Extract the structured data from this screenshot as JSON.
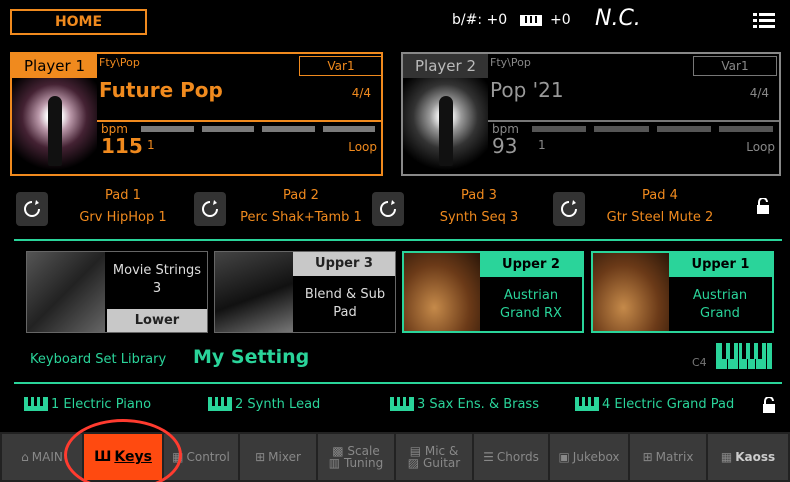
{
  "header": {
    "home_label": "HOME",
    "transpose_label": "b/#: +0",
    "octave_label": "+0",
    "chord_label": "N.C."
  },
  "player1": {
    "title": "Player 1",
    "folder": "Fty\\Pop",
    "variation": "Var1",
    "style": "Future Pop",
    "meter": "4/4",
    "bpm_label": "bpm",
    "bpm": "115",
    "beat": "1",
    "loop": "Loop"
  },
  "player2": {
    "title": "Player 2",
    "folder": "Fty\\Pop",
    "variation": "Var1",
    "style": "Pop '21",
    "meter": "4/4",
    "bpm_label": "bpm",
    "bpm": "93",
    "beat": "1",
    "loop": "Loop"
  },
  "pads": [
    {
      "name": "Pad 1",
      "sound": "Grv HipHop 1"
    },
    {
      "name": "Pad 2",
      "sound": "Perc Shak+Tamb 1"
    },
    {
      "name": "Pad 3",
      "sound": "Synth Seq 3"
    },
    {
      "name": "Pad 4",
      "sound": "Gtr Steel Mute 2"
    }
  ],
  "keyboard_sounds": {
    "lower": {
      "title": "Lower",
      "name_line1": "Movie Strings",
      "name_line2": "3"
    },
    "upper3": {
      "title": "Upper 3",
      "name_line1": "Blend & Sub",
      "name_line2": "Pad"
    },
    "upper2": {
      "title": "Upper 2",
      "name_line1": "Austrian",
      "name_line2": "Grand RX"
    },
    "upper1": {
      "title": "Upper 1",
      "name_line1": "Austrian",
      "name_line2": "Grand"
    }
  },
  "library": {
    "label": "Keyboard Set Library",
    "name": "My Setting",
    "octave": "C4"
  },
  "keyboard_sets": [
    {
      "label": "1  Electric Piano"
    },
    {
      "label": "2  Synth Lead"
    },
    {
      "label": "3  Sax Ens. & Brass"
    },
    {
      "label": "4  Electric Grand Pad"
    }
  ],
  "tabs": [
    {
      "label": "MAIN"
    },
    {
      "label": "Keys"
    },
    {
      "label": "Control"
    },
    {
      "label": "Mixer"
    },
    {
      "label": "Scale",
      "label2": "Tuning"
    },
    {
      "label": "Mic &",
      "label2": "Guitar"
    },
    {
      "label": "Chords"
    },
    {
      "label": "Jukebox"
    },
    {
      "label": "Matrix"
    },
    {
      "label": "Kaoss"
    }
  ],
  "colors": {
    "accent_orange": "#f08a1e",
    "accent_green": "#2ad49a",
    "active_tab": "#ff4a10",
    "highlight_circle": "#ff3b2f"
  }
}
